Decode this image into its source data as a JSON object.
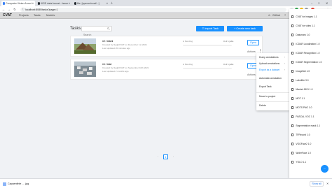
{
  "browser": {
    "tabs": [
      {
        "label": "Computer Vision Annot",
        "fav_color": "#3b82f6"
      },
      {
        "label": "KISS data format - Issue",
        "fav_color": "#24292f"
      },
      {
        "label": "file: [opencv/cvat/...]",
        "fav_color": "#24292f"
      }
    ],
    "new_tab": "+",
    "url": "localhost:8080/tasks?page=1",
    "window_controls": {
      "min": "–",
      "max": "□",
      "close": "✕"
    }
  },
  "app": {
    "logo": "CVAT",
    "nav": [
      "Projects",
      "Tasks",
      "Models"
    ],
    "header_right": {
      "github": "GitHub",
      "user": "Ilya",
      "help": "?"
    }
  },
  "tasks_page": {
    "title": "Tasks",
    "search_placeholder": "Search",
    "import_button": "Import Task",
    "create_button": "+   Create new task",
    "tasks": [
      {
        "id_name": "#2: ",
        "name": "test1",
        "created": "Created by Ilya@CVAT on December 1st 2021",
        "updated": "Last updated 20 minutes ago",
        "status": "● Pending",
        "jobs": "0 of 1 jobs",
        "progress": 0,
        "open_label": "Open",
        "actions_label": "Actions"
      },
      {
        "id_name": "#1: ",
        "name": "test",
        "created": "Created by Ilya@CVAT on September 10th 2021",
        "updated": "Last updated 2 months ago",
        "status": "● Pending",
        "jobs": "0 of 1 jobs",
        "progress": 0,
        "open_label": "Open",
        "actions_label": "Actions"
      }
    ],
    "actions_menu": [
      {
        "label": "Dump annotations",
        "chev": "›"
      },
      {
        "label": "Upload annotations",
        "chev": "›"
      },
      {
        "label": "Export as a dataset",
        "chev": "›"
      },
      {
        "label": "Automatic annotation",
        "chev": ""
      },
      {
        "label": "Export Task",
        "chev": ""
      },
      {
        "label": "Move to project",
        "chev": ""
      },
      {
        "label": "Delete",
        "chev": ""
      }
    ],
    "export_formats": [
      "CVAT for images 1.1",
      "CVAT for video 1.1",
      "Datumaro 1.0",
      "ICDAR Localization 1.0",
      "ICDAR Recognition 1.0",
      "ICDAR Segmentation 1.0",
      "ImageNet 1.0",
      "LabelMe 3.0",
      "Market-1501 1.0",
      "MOT 1.1",
      "MOTS PNG 1.0",
      "PASCAL VOC 1.1",
      "Segmentation mask 1.1",
      "TFRecord 1.0",
      "VGGFace2 1.0",
      "WiderFace 1.0",
      "YOLO 1.1"
    ],
    "pagination": {
      "prev": "‹",
      "current": "1",
      "next": "›"
    },
    "fab": "···"
  },
  "download_shelf": {
    "file": "Capaenfinte ... .jpg",
    "show_all": "Show all",
    "close": "✕"
  },
  "colors": {
    "accent": "#1890ff",
    "header_bg": "#d8d8d8",
    "content_bg": "#f0f2f5"
  }
}
